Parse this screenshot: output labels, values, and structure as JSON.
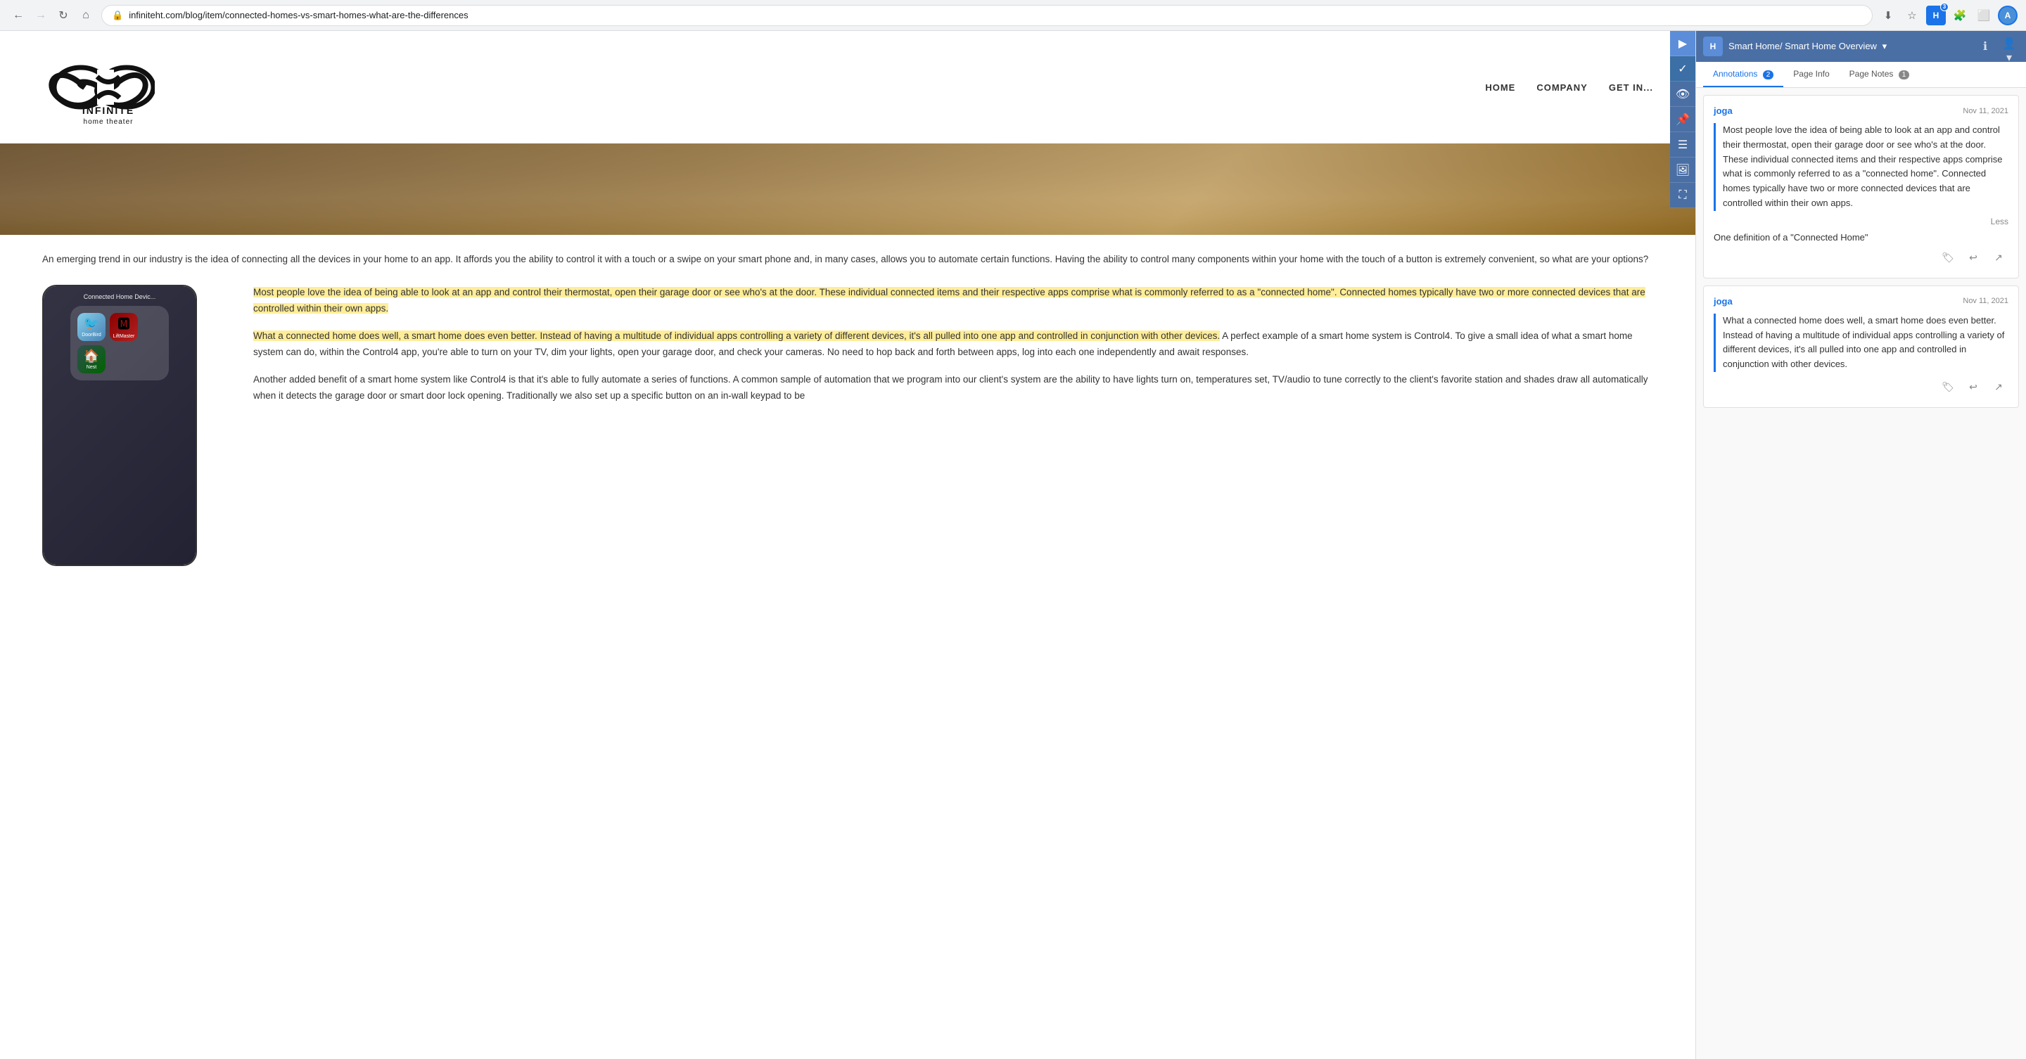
{
  "browser": {
    "back_disabled": false,
    "forward_disabled": true,
    "url": "infiniteht.com/blog/item/connected-homes-vs-smart-homes-what-are-the-differences",
    "actions": {
      "download": "⬇",
      "bookmark": "☆",
      "extension_label": "H",
      "extension_badge": "3",
      "profile": "A"
    }
  },
  "site": {
    "logo_infinite": "INFINITE",
    "logo_subtitle": "home theater",
    "nav": {
      "home": "HOME",
      "company": "COMPANY",
      "get_in_touch": "GET IN..."
    }
  },
  "article": {
    "intro": "An emerging trend in our industry is the idea of connecting all the devices in your home to an app. It affords you the ability to control it with a touch or a swipe on your smart phone and, in many cases, allows you to automate certain functions. Having the ability to control many components within your home with the touch of a button is extremely convenient, so what are your options?",
    "phone_label": "Connected Home Devic...",
    "app1_label": "DoorBird",
    "app2_label": "LiftMaster",
    "app3_label": "Nest",
    "paragraph1_normal": "Most people love the idea of being able to look at an app and control their thermostat, open their garage door or see who's at the door. These individual connected items and their respective apps comprise what is commonly referred to as a \"connected home\". Connected homes typically have two or more connected devices that are controlled within their own apps.",
    "paragraph1_highlighted": "Most people love the idea of being able to look at an app and control their thermostat, open their garage door or see who's at the door. These individual connected items and their respective apps comprise what is commonly referred to as a \"connected home\". Connected homes typically have two or more connected devices that are controlled within their own apps.",
    "paragraph2_highlighted": "What a connected home does well, a smart home does even better. Instead of having a multitude of individual apps controlling a variety of different devices, it's all pulled into one app and controlled in conjunction with other devices.",
    "paragraph2_normal": " A perfect example of a smart home system is Control4. To give a small idea of what a smart home system can do, within the Control4 app, you're able to turn on your TV, dim your lights, open your garage door, and check your cameras. No need to hop back and forth between apps, log into each one independently and await responses.",
    "paragraph3": "Another added benefit of a smart home system like Control4 is that it's able to fully automate a series of functions. A common sample of automation that we program into our client's system are the ability to have lights turn on, temperatures set, TV/audio to tune correctly to the client's favorite station and shades draw all automatically when it detects the garage door or smart door lock opening. Traditionally we also set up a specific button on an in-wall keypad to be"
  },
  "annotations_panel": {
    "title": "Smart Home/ Smart Home Overview",
    "tabs": {
      "annotations": "Annotations",
      "annotations_count": "2",
      "page_info": "Page Info",
      "page_notes": "Page Notes",
      "page_notes_count": "1"
    },
    "annotation1": {
      "user": "joga",
      "date": "Nov 11, 2021",
      "quote": "Most people love the idea of being able to look at an app and control their thermostat, open their garage door or see who's at the door. These individual connected items and their respective apps comprise what is commonly referred to as a \"connected home\". Connected homes typically have two or more connected devices that are controlled within their own apps.",
      "less_label": "Less",
      "ref": "One definition of a \"Connected Home\""
    },
    "annotation2": {
      "user": "joga",
      "date": "Nov 11, 2021",
      "quote": "What a connected home does well, a smart home does even better. Instead of having a multitude of individual apps controlling a variety of different devices, it's all pulled into one app and controlled in conjunction with other devices."
    }
  }
}
